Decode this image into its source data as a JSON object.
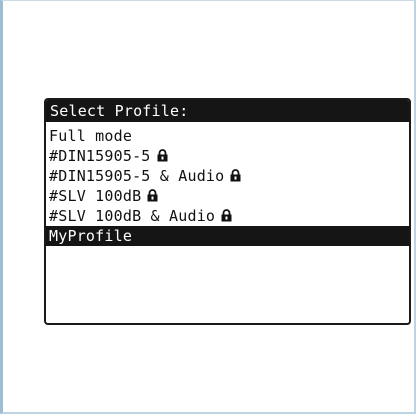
{
  "dialog": {
    "title": "Select Profile:",
    "items": [
      {
        "label": "Full mode",
        "locked": false,
        "selected": false
      },
      {
        "label": "#DIN15905-5",
        "locked": true,
        "selected": false
      },
      {
        "label": "#DIN15905-5 & Audio",
        "locked": true,
        "selected": false
      },
      {
        "label": "#SLV 100dB",
        "locked": true,
        "selected": false
      },
      {
        "label": "#SLV 100dB & Audio",
        "locked": true,
        "selected": false
      },
      {
        "label": "MyProfile",
        "locked": false,
        "selected": true
      }
    ]
  },
  "colors": {
    "highlight_bg": "#151515",
    "text": "#111111",
    "frame_border": "#9dbdd2"
  },
  "icons": {
    "lock": "lock-icon"
  }
}
